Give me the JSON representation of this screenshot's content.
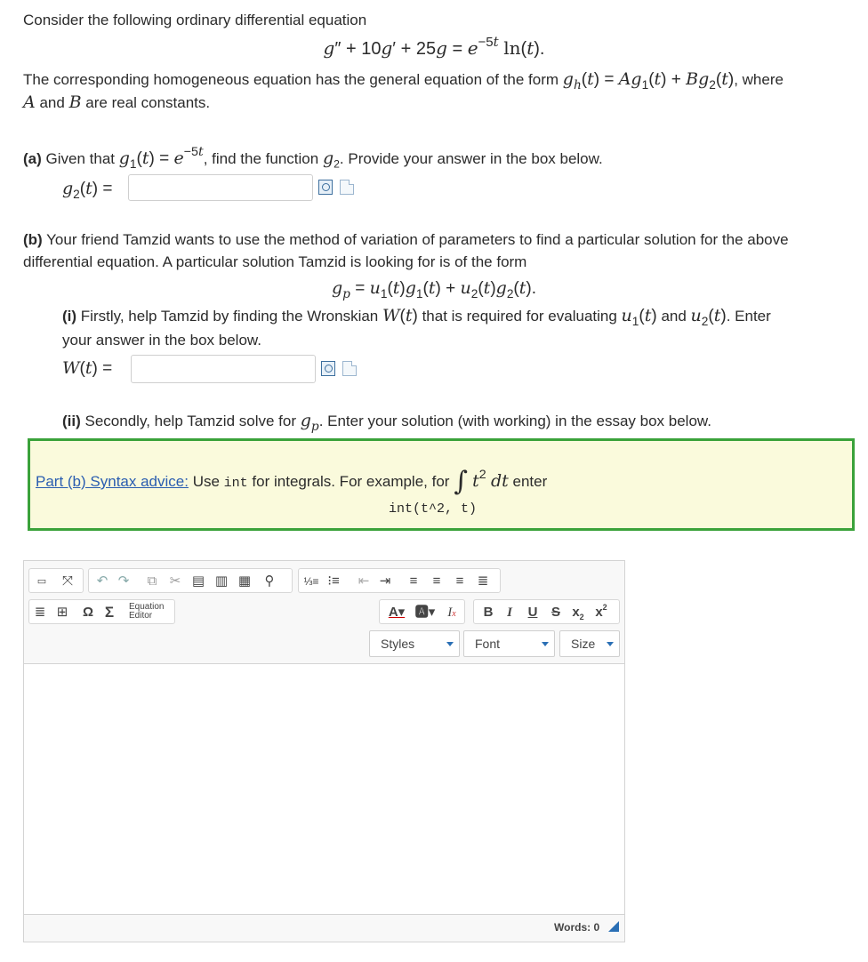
{
  "intro": "Consider the following ordinary differential equation",
  "homog_pre": "The corresponding homogeneous equation has the general equation of the form",
  "homog_post": ", where",
  "homog_line2_mid": "and",
  "homog_line2_end": "are real constants.",
  "part_a": {
    "label": "(a)",
    "text_pre": "Given that",
    "text_post": ", find the function",
    "text_end": ". Provide your answer in the box below.",
    "answer_value": ""
  },
  "part_b": {
    "label": "(b)",
    "line1": "Your friend Tamzid wants to use the method of variation of parameters to find a particular solution for the above",
    "line2": "differential equation. A particular solution Tamzid is looking for is of the form",
    "i_label": "(i)",
    "i_text1": "Firstly, help Tamzid by finding the Wronskian",
    "i_text2": "that is required for evaluating",
    "i_and": "and",
    "i_enter": ". Enter",
    "i_line2": "your answer in the box below.",
    "w_answer_value": "",
    "ii_label": "(ii)",
    "ii_text1": "Secondly, help Tamzid solve for",
    "ii_text2": ". Enter your solution (with working) in the essay box below."
  },
  "advice": {
    "link": "Part (b) Syntax advice:",
    "use": "Use",
    "code": "int",
    "for_integrals": "for integrals. For example, for",
    "enter": "enter",
    "example_code": "int(t^2, t)"
  },
  "editor": {
    "equation_editor_line1": "Equation",
    "equation_editor_line2": "Editor",
    "styles_label": "Styles",
    "font_label": "Font",
    "size_label": "Size",
    "word_count": "Words: 0",
    "icons": [
      "source-icon",
      "maximize-icon",
      "undo-icon",
      "redo-icon",
      "copy-icon",
      "cut-icon",
      "paste-icon",
      "paste-text-icon",
      "paste-word-icon",
      "find-icon",
      "numbered-list-icon",
      "bulleted-list-icon",
      "outdent-icon",
      "indent-icon",
      "align-left-icon",
      "align-center-icon",
      "align-right-icon",
      "justify-icon",
      "horizontal-rule-icon",
      "table-icon",
      "omega-icon",
      "sigma-icon",
      "font-color-icon",
      "background-color-icon",
      "remove-format-icon",
      "bold-icon",
      "italic-icon",
      "underline-icon",
      "strike-icon",
      "subscript-icon",
      "superscript-icon"
    ]
  },
  "colors": {
    "advice_border": "#3aa23a",
    "advice_bg": "#fafadc",
    "link": "#2a5db0",
    "combo_arrow": "#2a6fb5"
  }
}
